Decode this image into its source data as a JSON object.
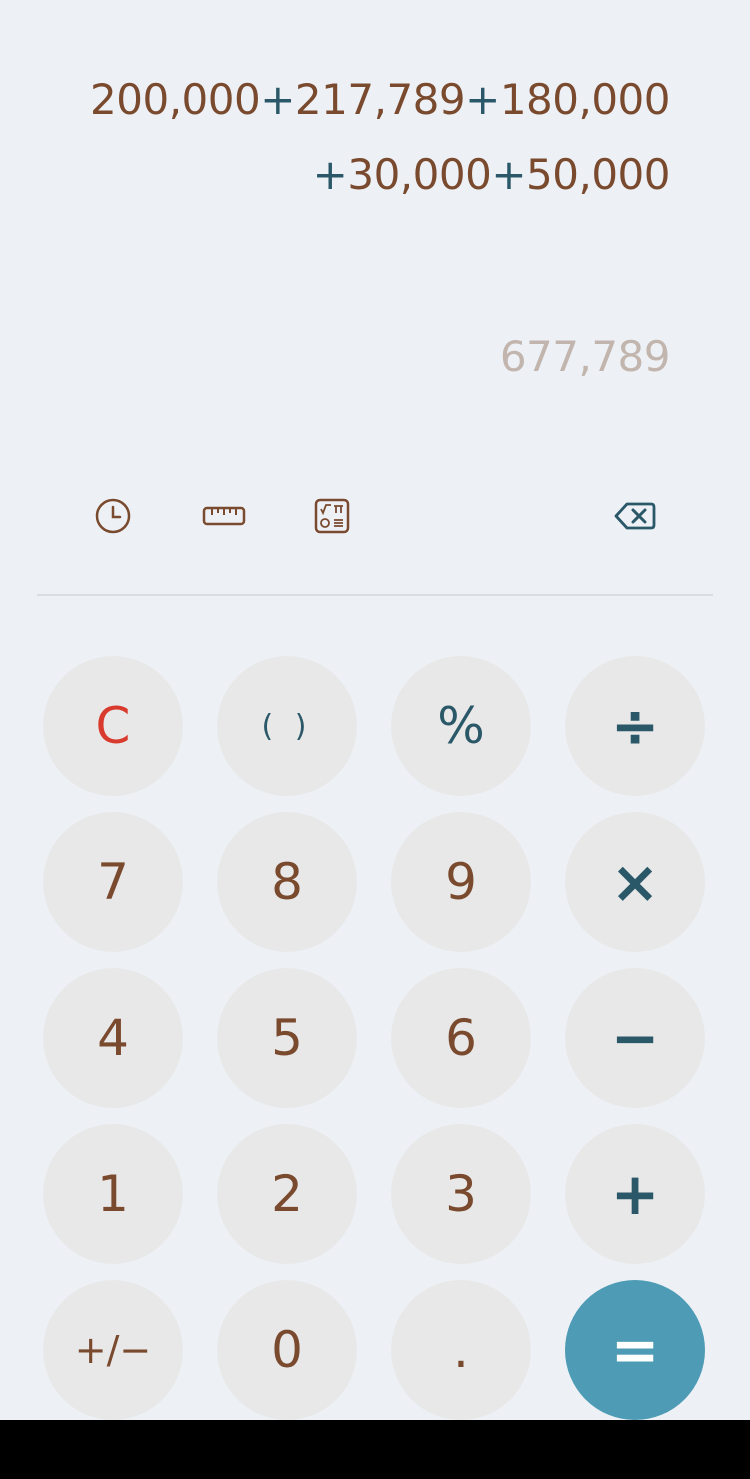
{
  "display": {
    "expression_line1_a": "200,000",
    "expression_line1_op1": "+",
    "expression_line1_b": "217,789",
    "expression_line1_op2": "+",
    "expression_line1_c": "180,000",
    "expression_line2_op1": "+",
    "expression_line2_a": "30,000",
    "expression_line2_op2": "+",
    "expression_line2_b": "50,000",
    "result": "677,789"
  },
  "toolbar": {
    "icons": [
      "history-icon",
      "unit-converter-icon",
      "scientific-mode-icon",
      "backspace-icon"
    ]
  },
  "keys": {
    "clear": "C",
    "parens": "( )",
    "percent": "%",
    "divide": "÷",
    "seven": "7",
    "eight": "8",
    "nine": "9",
    "multiply": "×",
    "four": "4",
    "five": "5",
    "six": "6",
    "minus": "−",
    "one": "1",
    "two": "2",
    "three": "3",
    "plus": "+",
    "negate": "+/−",
    "zero": "0",
    "decimal": ".",
    "equals": "="
  },
  "colors": {
    "background": "#edf1f6",
    "key_background": "#e8e8e8",
    "digit_color": "#7a4a2e",
    "operator_color": "#2a5868",
    "clear_color": "#d93a2e",
    "equals_background": "#4e9bb5",
    "result_color": "#c2b5ad"
  }
}
